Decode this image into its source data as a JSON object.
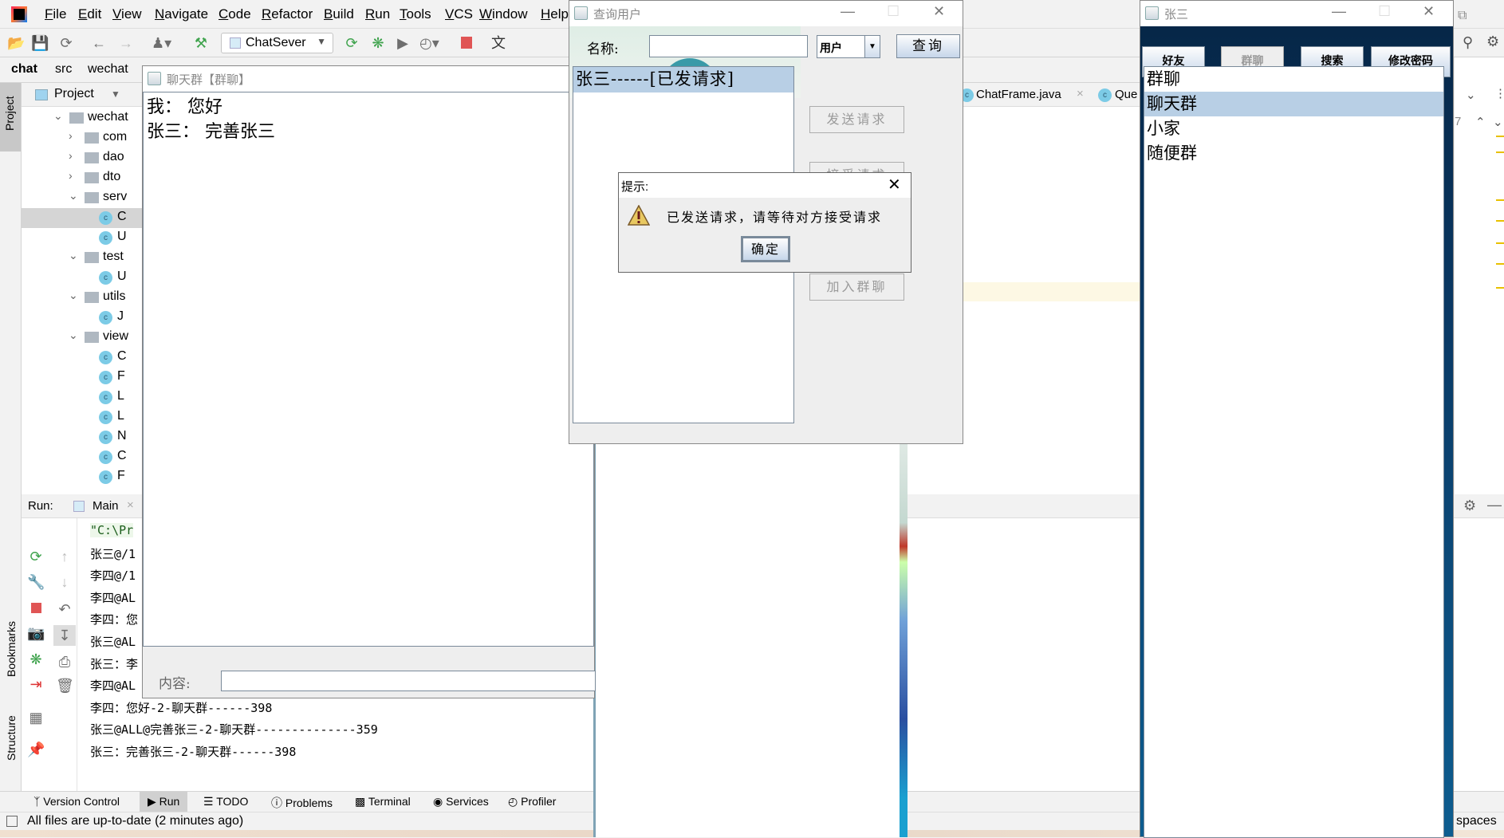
{
  "ide": {
    "menu": [
      "File",
      "Edit",
      "View",
      "Navigate",
      "Code",
      "Refactor",
      "Build",
      "Run",
      "Tools",
      "VCS",
      "Window",
      "Help"
    ],
    "run_config": "ChatSever",
    "breadcrumb": [
      "chat",
      "src",
      "wechat"
    ],
    "project_label": "Project",
    "side_labels": {
      "project": "Project",
      "bookmarks": "Bookmarks",
      "structure": "Structure"
    },
    "tree": [
      {
        "label": "wechat",
        "type": "folder",
        "level": 0,
        "open": true
      },
      {
        "label": "com",
        "type": "folder",
        "level": 1,
        "open": false
      },
      {
        "label": "dao",
        "type": "folder",
        "level": 1,
        "open": false
      },
      {
        "label": "dto",
        "type": "folder",
        "level": 1,
        "open": false
      },
      {
        "label": "serv",
        "type": "folder",
        "level": 1,
        "open": true
      },
      {
        "label": "C",
        "type": "class",
        "level": 2,
        "selected": true
      },
      {
        "label": "U",
        "type": "class",
        "level": 2
      },
      {
        "label": "test",
        "type": "folder",
        "level": 1,
        "open": true
      },
      {
        "label": "U",
        "type": "class",
        "level": 2
      },
      {
        "label": "utils",
        "type": "folder",
        "level": 1,
        "open": true
      },
      {
        "label": "J",
        "type": "class",
        "level": 2
      },
      {
        "label": "view",
        "type": "folder",
        "level": 1,
        "open": true
      },
      {
        "label": "C",
        "type": "class",
        "level": 2
      },
      {
        "label": "F",
        "type": "class",
        "level": 2
      },
      {
        "label": "L",
        "type": "class",
        "level": 2
      },
      {
        "label": "L",
        "type": "class",
        "level": 2
      },
      {
        "label": "N",
        "type": "class",
        "level": 2
      },
      {
        "label": "C",
        "type": "class",
        "level": 2
      },
      {
        "label": "F",
        "type": "class",
        "level": 2
      }
    ],
    "editor_tabs": [
      "ChatFrame.java",
      "Que"
    ],
    "match_count": "7",
    "run_label": "Run:",
    "run_tab": "Main",
    "console": [
      "\"C:\\Pr",
      "张三@/1",
      "李四@/1",
      "李四@AL",
      "李四：您",
      "张三@AL",
      "张三：李",
      "李四@AL",
      "李四：您好-2-聊天群------398",
      "张三@ALL@完善张三-2-聊天群--------------359",
      "张三：完善张三-2-聊天群------398"
    ],
    "bottom_tools": [
      "Version Control",
      "Run",
      "TODO",
      "Problems",
      "Terminal",
      "Services",
      "Profiler"
    ],
    "status": "All files are up-to-date (2 minutes ago)",
    "indent": "spaces"
  },
  "chat_window": {
    "title": "聊天群【群聊】",
    "messages": [
      "我：  您好",
      "张三：  完善张三"
    ],
    "content_label": "内容:",
    "content_value": ""
  },
  "query_window": {
    "title": "查询用户",
    "name_label": "名称:",
    "name_value": "",
    "type_select": "用户",
    "query_button": "查询",
    "results": [
      "张三------[已发请求]"
    ],
    "send_button": "发送请求",
    "accept_button": "接受请求",
    "join_button": "加入群聊"
  },
  "dialog": {
    "title": "提示:",
    "message": "已发送请求，请等待对方接受请求",
    "ok": "确定"
  },
  "user_window": {
    "title": "张三",
    "tabs": [
      "好友",
      "群聊",
      "搜索",
      "修改密码"
    ],
    "active_tab": "群聊",
    "groups": [
      "群聊",
      "聊天群",
      "小家",
      "随便群"
    ],
    "selected_group": "聊天群"
  },
  "colors": {
    "selection": "#b8cfe5",
    "stop": "#e05555",
    "run_green": "#3fa34d"
  }
}
